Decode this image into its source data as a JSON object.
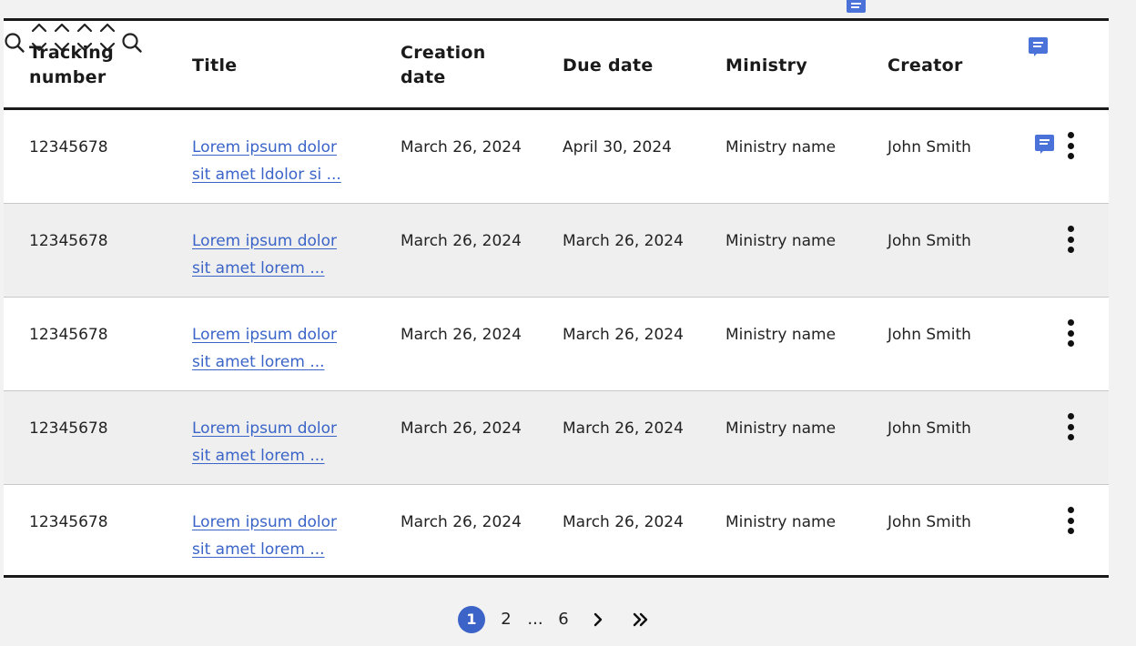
{
  "table": {
    "columns": [
      {
        "label": "Tracking\nnumber",
        "control": "search-icon"
      },
      {
        "label": "Title",
        "control": "sort-icon"
      },
      {
        "label": "Creation\ndate",
        "control": "sort-icon"
      },
      {
        "label": "Due date",
        "control": "sort-icon"
      },
      {
        "label": "Ministry",
        "control": "sort-icon"
      },
      {
        "label": "Creator",
        "control": "search-icon"
      }
    ],
    "rows": [
      {
        "tracking": "12345678",
        "title": "Lorem ipsum dolor sit amet ldolor si ...",
        "created": "March 26, 2024",
        "due": "April 30, 2024",
        "ministry": "Ministry name",
        "creator": "John Smith",
        "has_comment": true
      },
      {
        "tracking": "12345678",
        "title": "Lorem ipsum dolor sit amet lorem ...",
        "created": "March 26, 2024",
        "due": "March 26, 2024",
        "ministry": "Ministry name",
        "creator": "John Smith",
        "has_comment": false
      },
      {
        "tracking": "12345678",
        "title": "Lorem ipsum dolor sit amet lorem ...",
        "created": "March 26, 2024",
        "due": "March 26, 2024",
        "ministry": "Ministry name",
        "creator": "John Smith",
        "has_comment": false
      },
      {
        "tracking": "12345678",
        "title": "Lorem ipsum dolor sit amet lorem ...",
        "created": "March 26, 2024",
        "due": "March 26, 2024",
        "ministry": "Ministry name",
        "creator": "John Smith",
        "has_comment": false
      },
      {
        "tracking": "12345678",
        "title": "Lorem ipsum dolor sit amet lorem ...",
        "created": "March 26, 2024",
        "due": "March 26, 2024",
        "ministry": "Ministry name",
        "creator": "John Smith",
        "has_comment": false
      }
    ]
  },
  "pagination": {
    "current": "1",
    "page2": "2",
    "ellipsis": "...",
    "last": "6",
    "next_icon": "chevron-right-icon",
    "last_icon": "double-chevron-right-icon"
  },
  "colors": {
    "accent": "#3b63c8",
    "link": "#3a64c8",
    "comment_icon": "#4a72d8"
  }
}
